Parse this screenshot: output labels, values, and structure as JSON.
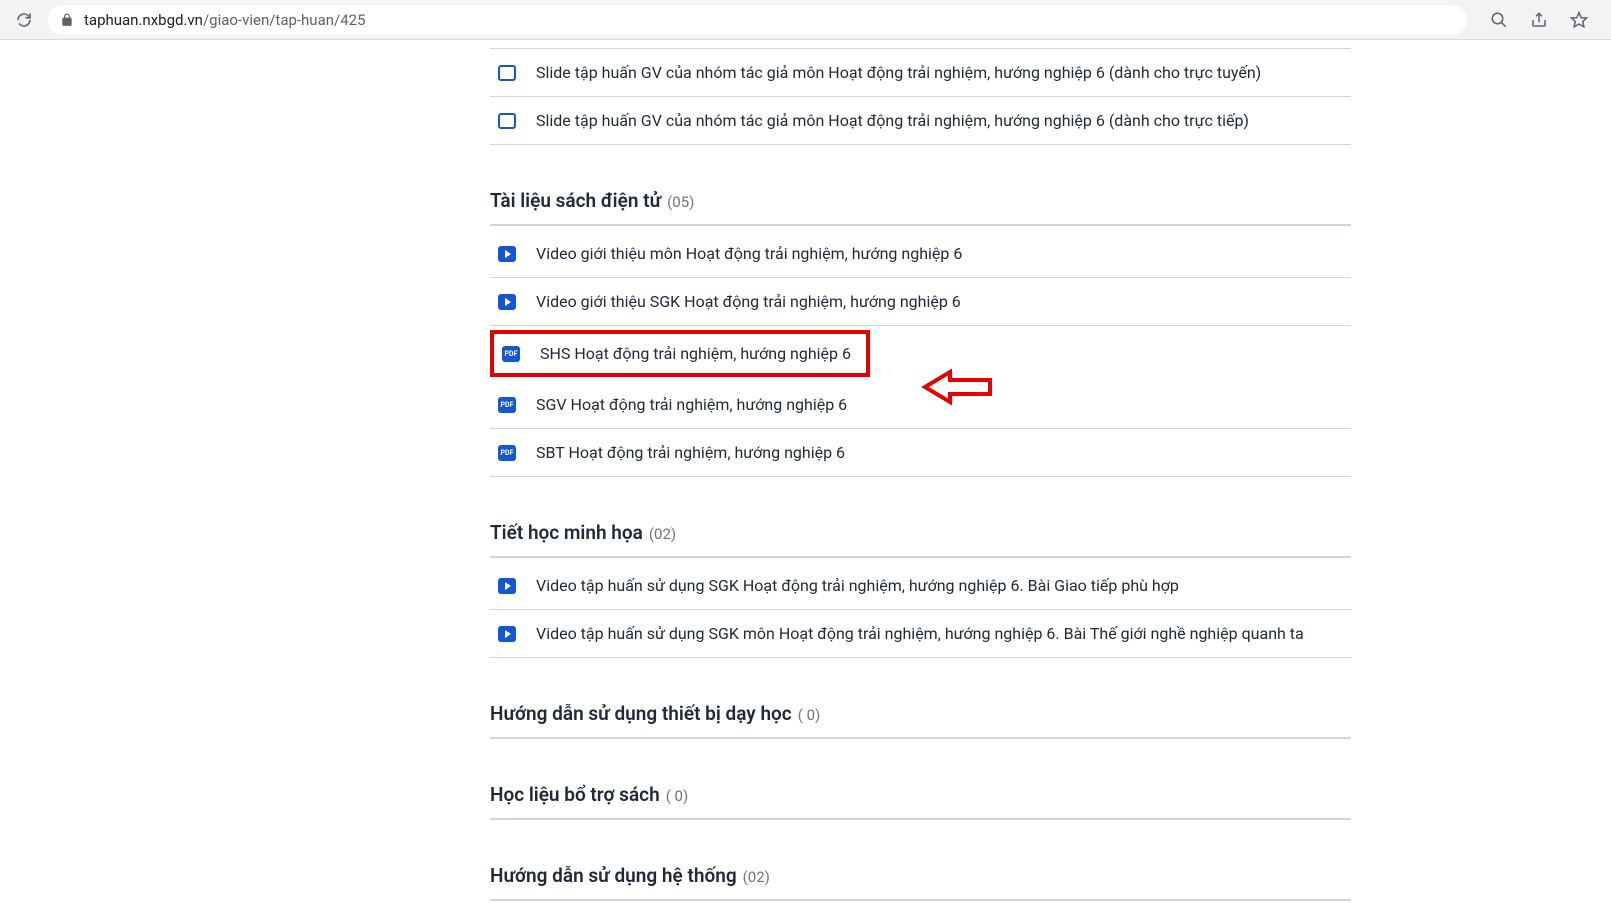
{
  "browser": {
    "url_domain": "taphuan.nxbgd.vn",
    "url_path": "/giao-vien/tap-huan/425"
  },
  "top_items": [
    {
      "icon": "slide",
      "label": "Slide tập huấn GV của nhóm tác giả môn Hoạt động trải nghiệm, hướng nghiệp 6 (dành cho trực tuyến)"
    },
    {
      "icon": "slide",
      "label": "Slide tập huấn GV của nhóm tác giả môn Hoạt động trải nghiệm, hướng nghiệp 6 (dành cho trực tiếp)"
    }
  ],
  "sections": [
    {
      "title": "Tài liệu sách điện tử",
      "count": "(05)",
      "items": [
        {
          "icon": "video",
          "label": "Video giới thiệu môn Hoạt động trải nghiệm, hướng nghiệp 6",
          "highlight": false
        },
        {
          "icon": "video",
          "label": "Video giới thiệu SGK Hoạt động trải nghiệm, hướng nghiệp 6",
          "highlight": false
        },
        {
          "icon": "pdf",
          "label": "SHS Hoạt động trải nghiệm, hướng nghiệp 6",
          "highlight": true
        },
        {
          "icon": "pdf",
          "label": "SGV Hoạt động trải nghiệm, hướng nghiệp 6",
          "highlight": false
        },
        {
          "icon": "pdf",
          "label": "SBT Hoạt động trải nghiệm, hướng nghiệp 6",
          "highlight": false
        }
      ]
    },
    {
      "title": "Tiết học minh họa",
      "count": "(02)",
      "items": [
        {
          "icon": "video",
          "label": "Video tập huấn sử dụng SGK Hoạt động trải nghiệm, hướng nghiệp 6. Bài Giao tiếp phù hợp",
          "highlight": false
        },
        {
          "icon": "video",
          "label": "Video tập huấn sử dụng SGK môn Hoạt động trải nghiệm, hướng nghiệp 6. Bài Thế giới nghề nghiệp quanh ta",
          "highlight": false
        }
      ]
    },
    {
      "title": "Hướng dẫn sử dụng thiết bị dạy học",
      "count": "( 0)",
      "items": []
    },
    {
      "title": "Học liệu bổ trợ sách",
      "count": "( 0)",
      "items": []
    },
    {
      "title": "Hướng dẫn sử dụng hệ thống",
      "count": "(02)",
      "items": []
    }
  ],
  "icon_names": {
    "slide": "slide-icon",
    "video": "video-icon",
    "pdf": "pdf-icon"
  },
  "pdf_text": "PDF"
}
